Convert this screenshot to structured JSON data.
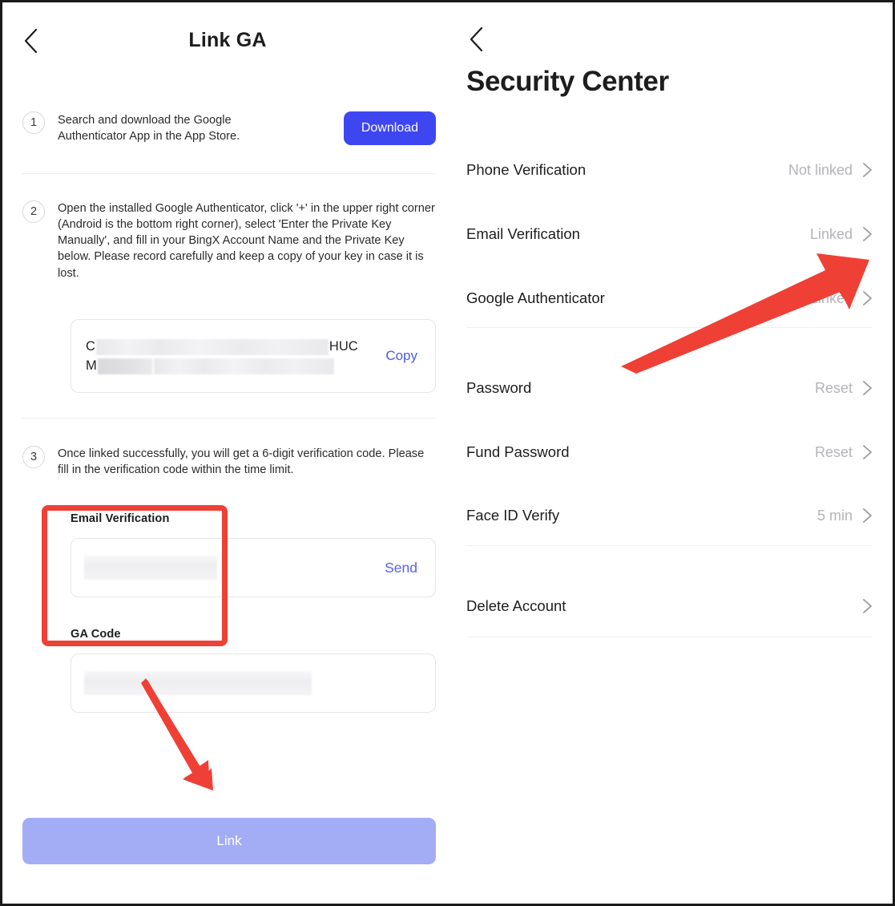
{
  "window": {
    "border_color": "#1a1a1a"
  },
  "left_panel": {
    "back_icon": "chevron-left-icon",
    "title": "Link GA",
    "steps": [
      {
        "number": "1",
        "text": "Search and download the Google Authenticator App in the App Store.",
        "button_label": "Download"
      },
      {
        "number": "2",
        "text": "Open the installed Google Authenticator, click '+' in the upper right corner (Android is the bottom right corner), select 'Enter the Private Key Manually', and fill in your BingX Account Name and the Private Key below. Please record carefully and keep a copy of your key in case it is lost."
      },
      {
        "number": "3",
        "text": "Once linked successfully, you will get a 6-digit verification code. Please fill in the verification code within the time limit."
      }
    ],
    "key_box": {
      "line1_prefix": "C",
      "line1_suffix": "HUC",
      "line2_prefix": "M",
      "line2_suffix": "",
      "copy_label": "Copy",
      "redacted": true
    },
    "fields": [
      {
        "label": "Email Verification",
        "value": "",
        "placeholder": "",
        "action_label": "Send",
        "redacted": true
      },
      {
        "label": "GA Code",
        "value": "",
        "placeholder": "",
        "action_label": "",
        "redacted": true
      }
    ],
    "submit_button": {
      "label": "Link",
      "disabled": true,
      "color": "#a3adf5"
    },
    "annotations": {
      "highlight_box_color": "#ef4036",
      "arrow_color": "#ef4036"
    }
  },
  "right_panel": {
    "back_icon": "chevron-left-icon",
    "title": "Security Center",
    "items": [
      {
        "label": "Phone Verification",
        "value": "Not linked"
      },
      {
        "label": "Email Verification",
        "value": "Linked"
      },
      {
        "label": "Google Authenticator",
        "value": "Linked"
      },
      {
        "label": "Password",
        "value": "Reset"
      },
      {
        "label": "Fund Password",
        "value": "Reset"
      },
      {
        "label": "Face ID Verify",
        "value": "5 min"
      },
      {
        "label": "Delete Account",
        "value": ""
      }
    ]
  },
  "colors": {
    "accent_blue": "#3e46f2",
    "link_blue": "#4b5af5",
    "annotation_red": "#ef4036",
    "disabled_button": "#a3adf5",
    "muted_text": "#b4b4ba"
  }
}
